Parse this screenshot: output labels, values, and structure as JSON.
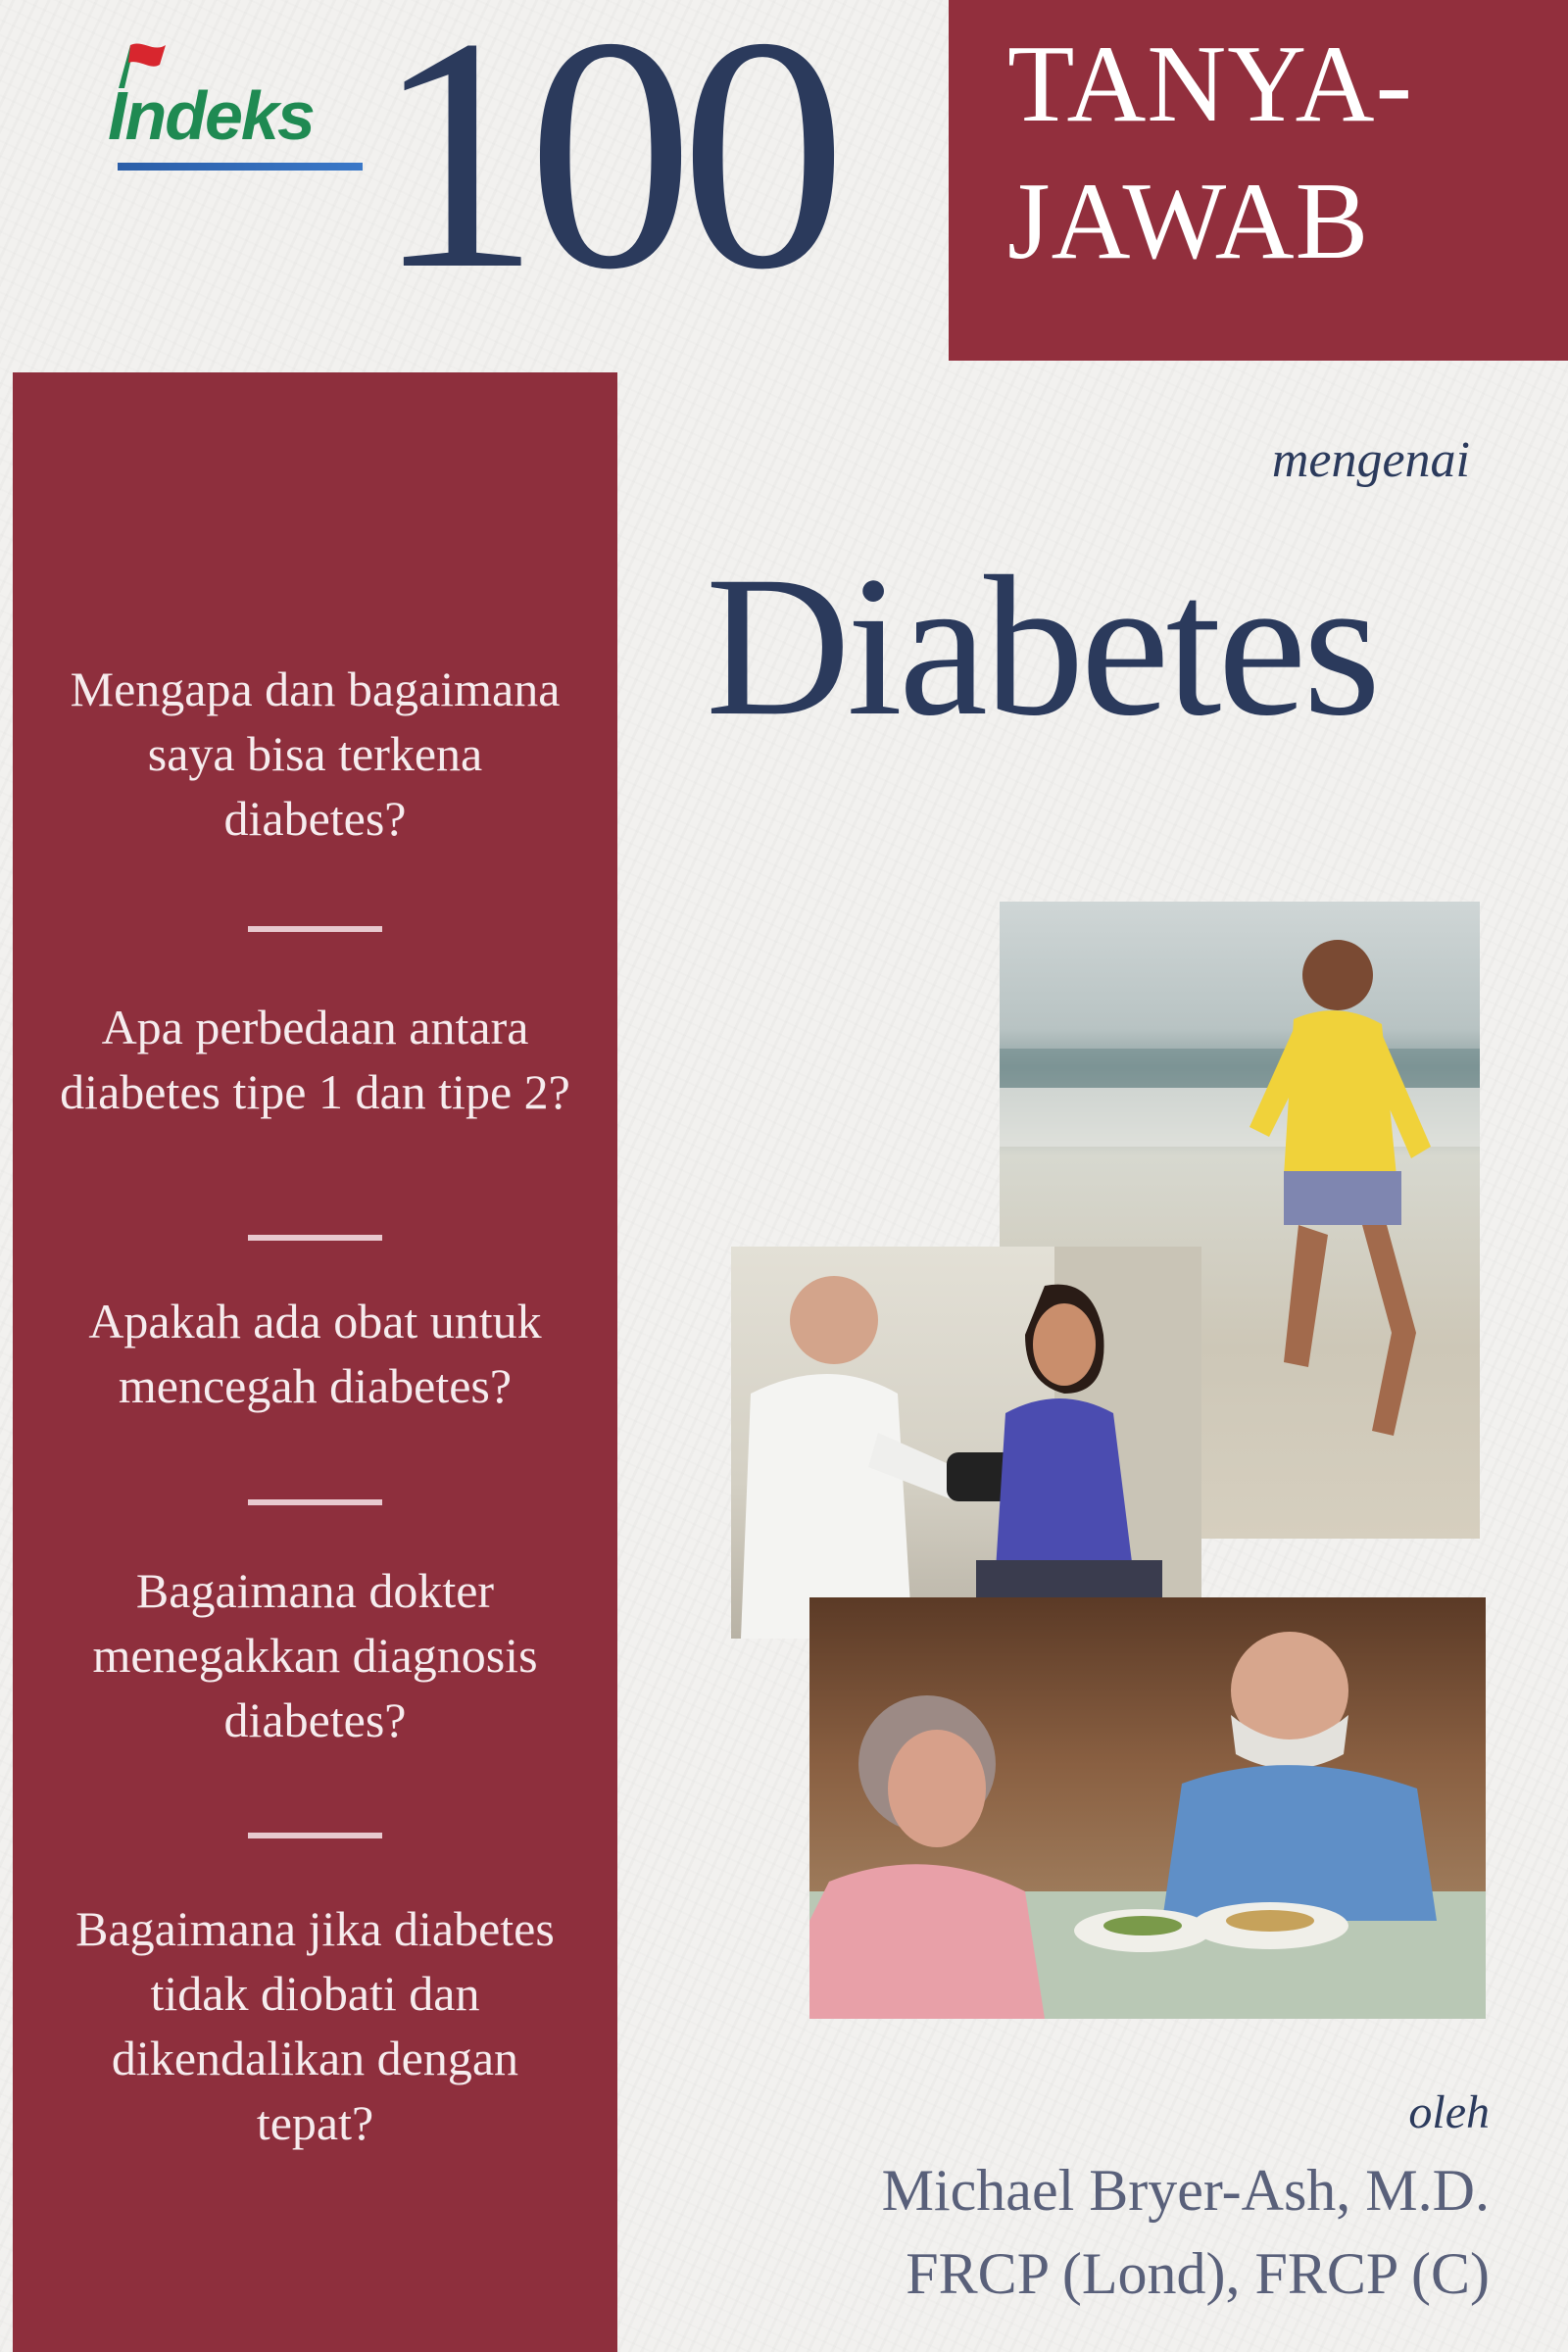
{
  "publisher": {
    "logo_text": "Indeks"
  },
  "cover": {
    "number": "100",
    "title_line1": "TANYA-",
    "title_line2": "JAWAB",
    "mengenai": "mengenai",
    "subject": "Diabetes"
  },
  "questions": [
    "Mengapa dan bagaimana saya bisa terkena diabetes?",
    "Apa perbedaan antara diabetes tipe 1 dan tipe 2?",
    "Apakah ada obat untuk mencegah diabetes?",
    "Bagaimana dokter menegakkan diagnosis diabetes?",
    "Bagaimana jika diabetes tidak diobati dan dikendalikan dengan tepat?"
  ],
  "byline": {
    "oleh": "oleh",
    "author_line1": "Michael Bryer-Ash, M.D.",
    "author_line2": "FRCP (Lond), FRCP (C)"
  },
  "colors": {
    "maroon": "#922f3d",
    "navy": "#2b3a5c",
    "logo_green": "#1f8a52",
    "logo_blue": "#2b5ea8"
  }
}
